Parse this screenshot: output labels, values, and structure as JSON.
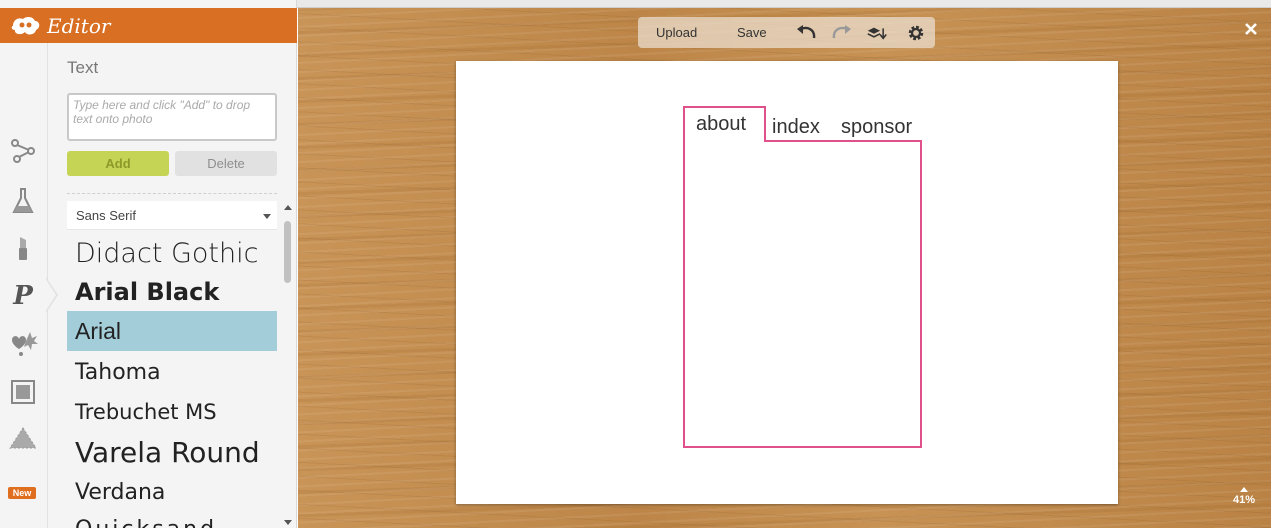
{
  "app": {
    "title": "Editor"
  },
  "text_panel": {
    "heading": "Text",
    "input_placeholder": "Type here and click \"Add\" to drop text onto photo",
    "add_label": "Add",
    "delete_label": "Delete",
    "font_category": "Sans Serif",
    "fonts": [
      {
        "name": "Didact Gothic",
        "selected": false
      },
      {
        "name": "Arial Black",
        "selected": false
      },
      {
        "name": "Arial",
        "selected": true
      },
      {
        "name": "Tahoma",
        "selected": false
      },
      {
        "name": "Trebuchet MS",
        "selected": false
      },
      {
        "name": "Varela Round",
        "selected": false
      },
      {
        "name": "Verdana",
        "selected": false
      },
      {
        "name": "Quicksand",
        "selected": false
      }
    ]
  },
  "rail": {
    "items": [
      {
        "icon": "nodes-icon"
      },
      {
        "icon": "flask-icon"
      },
      {
        "icon": "lipstick-icon"
      },
      {
        "icon": "text-p-icon",
        "active": true
      },
      {
        "icon": "stickers-icon"
      },
      {
        "icon": "frame-icon"
      },
      {
        "icon": "texture-icon"
      }
    ],
    "new_badge": "New"
  },
  "toolbar": {
    "upload_label": "Upload",
    "save_label": "Save",
    "icons": [
      "undo-icon",
      "redo-icon",
      "layers-icon",
      "settings-icon"
    ]
  },
  "canvas": {
    "words": [
      "about",
      "index",
      "sponsor"
    ]
  },
  "zoom": {
    "level": "41%"
  },
  "colors": {
    "brand_orange": "#d86f22",
    "selection_pink": "#e0508b",
    "font_selected_bg": "#a3cdd9",
    "add_button": "#c6d456"
  }
}
